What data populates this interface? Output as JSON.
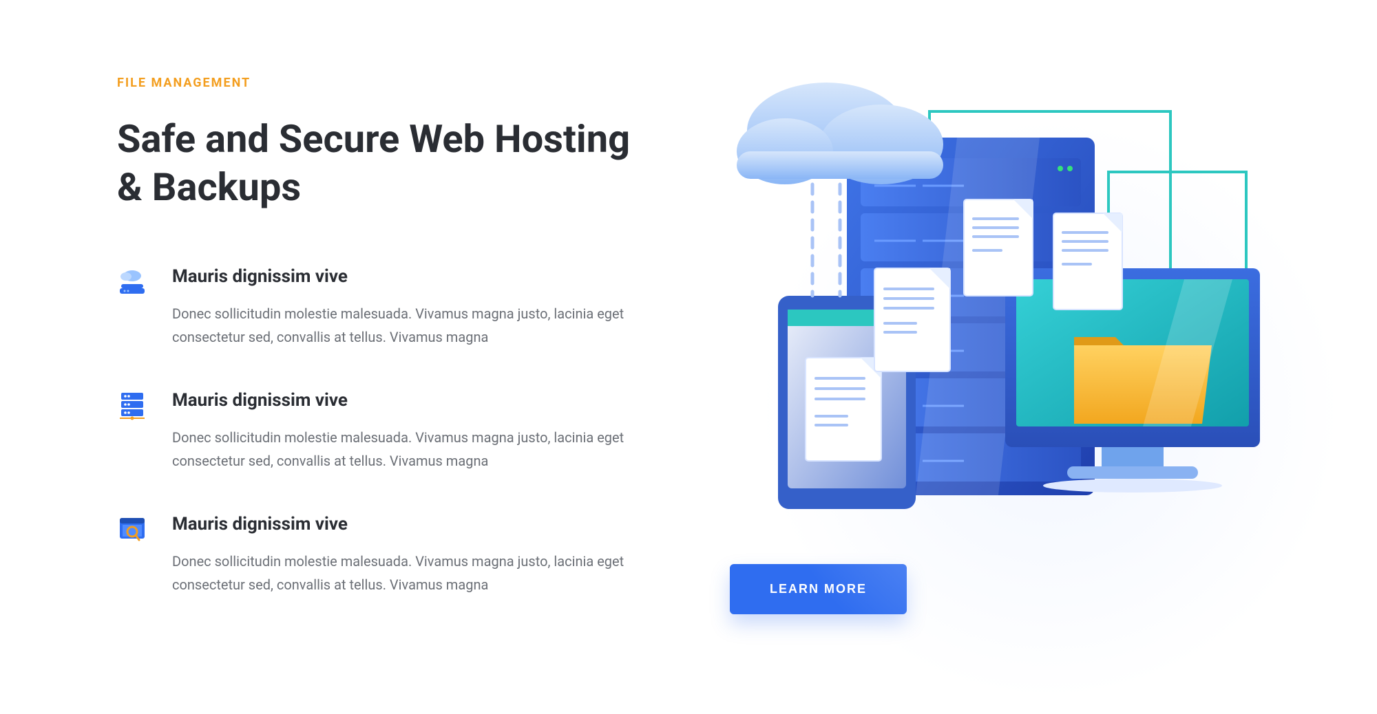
{
  "eyebrow": "FILE MANAGEMENT",
  "title": "Safe and Secure Web Hosting & Backups",
  "features": [
    {
      "icon": "cloud-server-icon",
      "title": "Mauris dignissim vive",
      "desc": "Donec sollicitudin molestie malesuada. Vivamus magna justo, lacinia eget consectetur sed, convallis at tellus. Vivamus magna"
    },
    {
      "icon": "server-rack-icon",
      "title": "Mauris dignissim vive",
      "desc": "Donec sollicitudin molestie malesuada. Vivamus magna justo, lacinia eget consectetur sed, convallis at tellus. Vivamus magna"
    },
    {
      "icon": "browser-search-icon",
      "title": "Mauris dignissim vive",
      "desc": "Donec sollicitudin molestie malesuada. Vivamus magna justo, lacinia eget consectetur sed, convallis at tellus. Vivamus magna"
    }
  ],
  "cta_label": "LEARN MORE",
  "colors": {
    "accent_orange": "#f39e1f",
    "heading": "#2a2d33",
    "body": "#6b6f76",
    "primary_blue": "#2f6df0"
  }
}
